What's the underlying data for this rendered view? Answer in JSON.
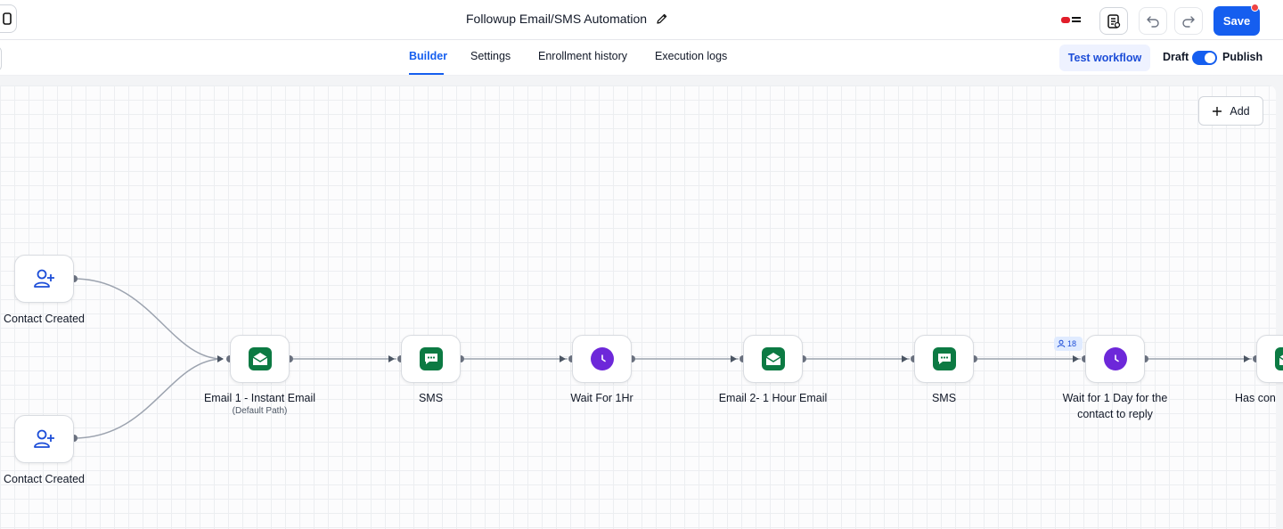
{
  "header": {
    "title": "Followup Email/SMS Automation",
    "save_label": "Save",
    "icons": [
      "panel-toggle-icon",
      "pencil-icon",
      "brand-logo",
      "clipboard-list-icon",
      "undo-icon",
      "redo-icon"
    ]
  },
  "subnav": {
    "tabs": [
      {
        "label": "Builder",
        "active": true
      },
      {
        "label": "Settings",
        "active": false
      },
      {
        "label": "Enrollment history",
        "active": false
      },
      {
        "label": "Execution logs",
        "active": false
      }
    ],
    "test_label": "Test workflow",
    "draft_label": "Draft",
    "publish_label": "Publish",
    "publish_enabled": true
  },
  "canvas": {
    "add_label": "Add",
    "triggers": [
      {
        "label": "Contact Created",
        "icon": "user-plus-icon"
      },
      {
        "label": "Contact Created",
        "icon": "user-plus-icon"
      }
    ],
    "actions": [
      {
        "label": "Email 1 - Instant Email",
        "sublabel": "(Default Path)",
        "icon": "email-icon",
        "color": "#0c7a43"
      },
      {
        "label": "SMS",
        "icon": "chat-icon",
        "color": "#0c7a43"
      },
      {
        "label": "Wait For 1Hr",
        "icon": "clock-icon",
        "color": "#6d28d9"
      },
      {
        "label": "Email 2- 1 Hour Email",
        "icon": "email-icon",
        "color": "#0c7a43"
      },
      {
        "label": "SMS",
        "icon": "chat-icon",
        "color": "#0c7a43"
      },
      {
        "label_line1": "Wait for 1 Day for the",
        "label_line2": "contact to reply",
        "icon": "clock-icon",
        "color": "#6d28d9",
        "enrolled_count": "18"
      },
      {
        "label": "Has con",
        "icon": "email-icon",
        "color": "#0c7a43"
      }
    ]
  },
  "colors": {
    "accent": "#155eef",
    "email_green": "#0c7a43",
    "wait_purple": "#6d28d9",
    "notification_dot": "#ef4444"
  }
}
